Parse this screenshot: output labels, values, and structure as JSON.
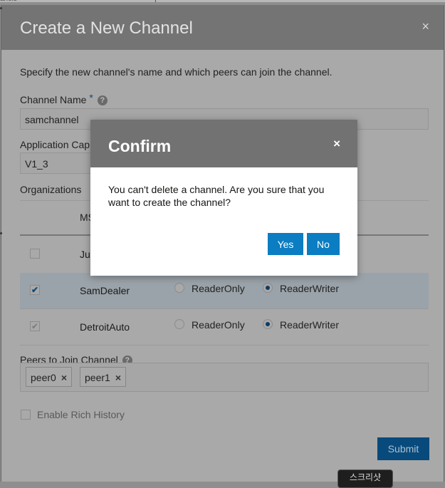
{
  "background_app": {
    "partial_text": "anels"
  },
  "main_dialog": {
    "title": "Create a New Channel",
    "close_glyph": "×",
    "description": "Specify the new channel's name and which peers can join the channel.",
    "channel_name": {
      "label": "Channel Name",
      "required_marker": "*",
      "help_glyph": "?",
      "value": "samchannel"
    },
    "application_cap": {
      "label": "Application Cap",
      "value": "V1_3"
    },
    "organizations": {
      "label": "Organizations",
      "msp_header": "MS",
      "rows": [
        {
          "name": "Ju",
          "checked": false,
          "reader_only_label": "",
          "reader_writer_label": ""
        },
        {
          "name": "SamDealer",
          "checked": true,
          "reader_only_label": "ReaderOnly",
          "reader_writer_label": "ReaderWriter",
          "selected_role": "ReaderWriter"
        },
        {
          "name": "DetroitAuto",
          "checked": true,
          "reader_only_label": "ReaderOnly",
          "reader_writer_label": "ReaderWriter",
          "selected_role": "ReaderWriter"
        }
      ]
    },
    "peers": {
      "label": "Peers to Join Channel",
      "help_glyph": "?",
      "chips": [
        {
          "label": "peer0",
          "remove_glyph": "×"
        },
        {
          "label": "peer1",
          "remove_glyph": "×"
        }
      ]
    },
    "rich_history": {
      "label": "Enable Rich History",
      "checked": false
    },
    "submit_label": "Submit"
  },
  "confirm_dialog": {
    "title": "Confirm",
    "close_glyph": "×",
    "message": "You can't delete a channel. Are you sure that you want to create the channel?",
    "yes_label": "Yes",
    "no_label": "No"
  },
  "tooltip": {
    "text": "스크리샷"
  },
  "colors": {
    "accent": "#0b7dc2",
    "header_gray": "#727272",
    "submit_blue": "#084a7b"
  }
}
